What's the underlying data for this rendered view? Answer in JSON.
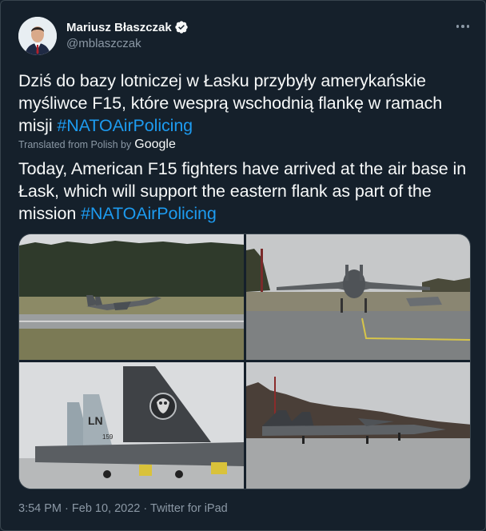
{
  "author": {
    "name": "Mariusz Błaszczak",
    "handle": "@mblaszczak",
    "verified": true,
    "avatar_icon": "profile-photo"
  },
  "tweet": {
    "original_text": "Dziś do bazy lotniczej w Łasku przybyły amerykańskie myśliwce F15, które wesprą wschodnią flankę w ramach misji ",
    "original_hashtag": "#NATOAirPolicing",
    "translated_label": "Translated from Polish by",
    "translator": "Google",
    "translated_text": "Today, American F15 fighters have arrived at the air base in Łask, which will support the eastern flank as part of the mission ",
    "translated_hashtag": "#NATOAirPolicing",
    "media_count": 4,
    "tail_marking": "LN",
    "tail_serial": "159"
  },
  "footer": {
    "time": "3:54 PM",
    "separator1": "·",
    "date": "Feb 10, 2022",
    "separator2": "·",
    "source": "Twitter for iPad"
  },
  "colors": {
    "background": "#15202b",
    "text": "#f7f9f9",
    "secondary": "#8b98a5",
    "link": "#1d9bf0",
    "border": "#38444d"
  }
}
